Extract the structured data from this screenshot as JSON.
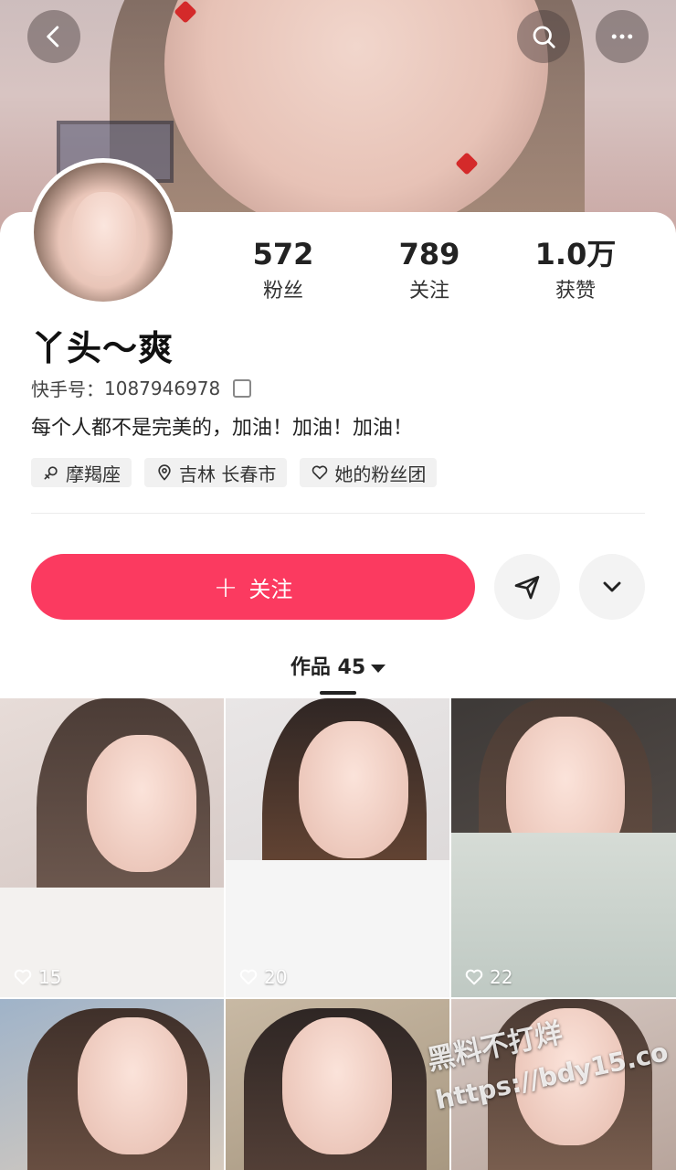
{
  "profile": {
    "name": "丫头～爽",
    "kuaishou_id_label": "快手号：",
    "kuaishou_id": "1087946978",
    "bio": "每个人都不是完美的，加油！加油！加油！",
    "tags": [
      {
        "icon": "female-symbol-icon",
        "label": "摩羯座"
      },
      {
        "icon": "location-pin-icon",
        "label": "吉林 长春市"
      },
      {
        "icon": "heart-outline-icon",
        "label": "她的粉丝团"
      }
    ]
  },
  "stats": [
    {
      "value": "572",
      "label": "粉丝"
    },
    {
      "value": "789",
      "label": "关注"
    },
    {
      "value": "1.0万",
      "label": "获赞"
    }
  ],
  "actions": {
    "follow_label": "关注",
    "follow_plus": "+"
  },
  "works": {
    "tab_label": "作品 45",
    "items": [
      {
        "likes": "15"
      },
      {
        "likes": "20"
      },
      {
        "likes": "22"
      },
      {
        "likes": ""
      },
      {
        "likes": ""
      },
      {
        "likes": ""
      }
    ]
  },
  "watermark": {
    "line1": "黑料不打烊",
    "line2": "https://bdy15.co"
  },
  "colors": {
    "accent": "#fb3a60",
    "tag_bg": "#f1f1f1"
  }
}
